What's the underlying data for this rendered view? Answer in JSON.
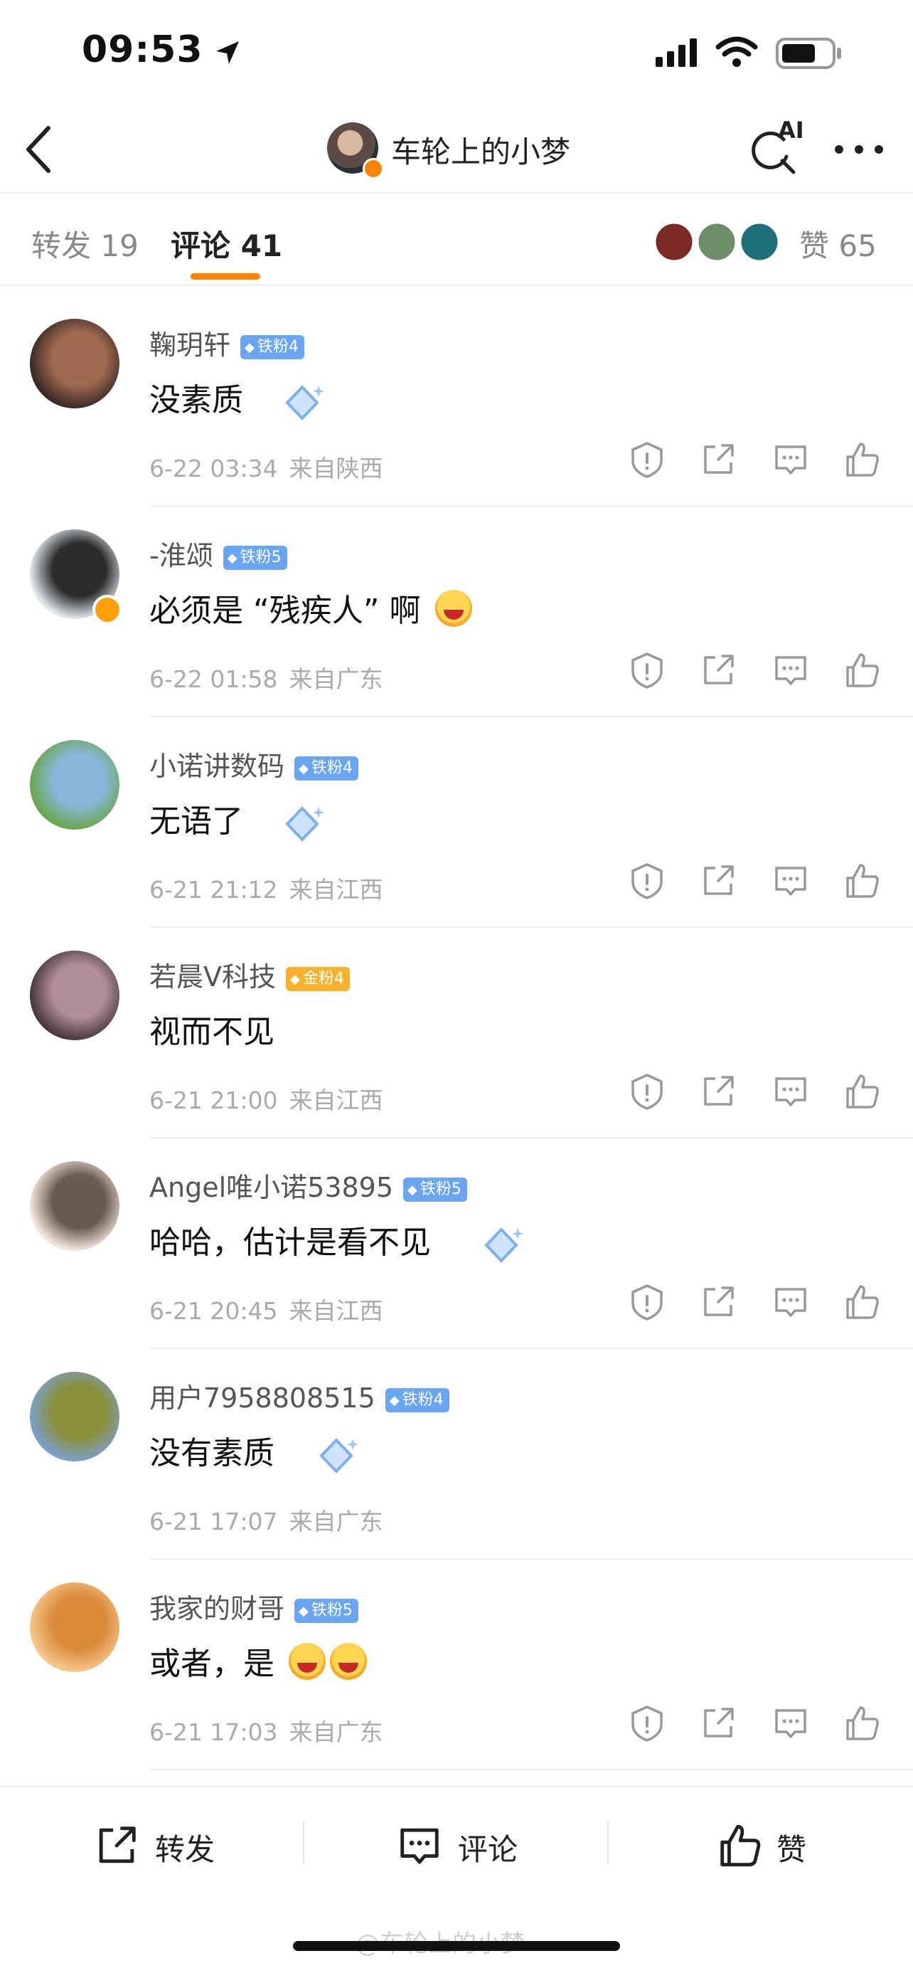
{
  "status_bar": {
    "time": "09:53"
  },
  "header": {
    "title": "车轮上的小梦",
    "ai_label": "AI"
  },
  "tabs": {
    "repost_label": "转发 19",
    "comment_label": "评论 41",
    "likes_label": "赞 65"
  },
  "comments": [
    {
      "name": "鞠玥轩",
      "badge": "铁粉4",
      "badge_type": "iron",
      "text": "没素质",
      "date": "6-22 03:34",
      "location": "来自陕西",
      "verified": false,
      "avatar_colors": [
        "#3b2a26",
        "#a06a50"
      ]
    },
    {
      "name": "-淮颂",
      "badge": "铁粉5",
      "badge_type": "iron",
      "text_before": "必须是 “残疾人” 啊",
      "emoji": "laughing-emoji",
      "date": "6-22 01:58",
      "location": "来自广东",
      "verified": true,
      "avatar_colors": [
        "#dfe6ea",
        "#2c2c2c"
      ]
    },
    {
      "name": "小诺讲数码",
      "badge": "铁粉4",
      "badge_type": "iron",
      "text": "无语了",
      "date": "6-21 21:12",
      "location": "来自江西",
      "verified": false,
      "avatar_colors": [
        "#6aa84f",
        "#87b6d8"
      ]
    },
    {
      "name": "若晨Ⅴ科技",
      "badge": "金粉4",
      "badge_type": "gold",
      "text": "视而不见",
      "date": "6-21 21:00",
      "location": "来自江西",
      "verified": false,
      "avatar_colors": [
        "#4a3a3f",
        "#b08d97"
      ]
    },
    {
      "name": "Angel唯小诺53895",
      "badge": "铁粉5",
      "badge_type": "iron",
      "text": "哈哈，估计是看不见",
      "date": "6-21 20:45",
      "location": "来自江西",
      "verified": false,
      "avatar_colors": [
        "#f2e4dc",
        "#6b5a50"
      ]
    },
    {
      "name": "用户7958808515",
      "badge": "铁粉4",
      "badge_type": "iron",
      "text": "没有素质",
      "date": "6-21 17:07",
      "location": "来自广东",
      "verified": false,
      "avatar_colors": [
        "#7aa0c8",
        "#8a8f3c"
      ]
    },
    {
      "name": "我家的财哥",
      "badge": "铁粉5",
      "badge_type": "iron",
      "text_before": "或者，是",
      "emoji": "tears-of-joy-emoji",
      "date": "6-21 17:03",
      "location": "来自广东",
      "verified": false,
      "avatar_colors": [
        "#f5c58a",
        "#d98b3a"
      ]
    }
  ],
  "bottom_bar": {
    "repost": "转发",
    "comment": "评论",
    "like": "赞"
  },
  "watermark": "@车轮上的小梦",
  "colors": {
    "accent": "#ff8200",
    "iron_badge": "#6aa5f3",
    "gold_badge": "#f7b12b"
  }
}
